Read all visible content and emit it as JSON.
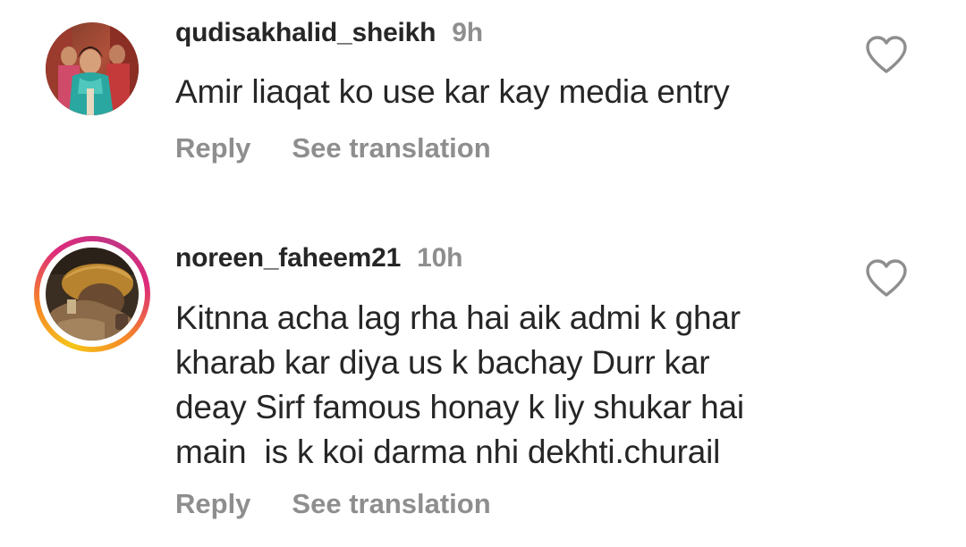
{
  "comments": [
    {
      "username": "qudisakhalid_sheikh",
      "time": "9h",
      "text": "Amir liaqat ko use kar kay media entry",
      "reply_label": "Reply",
      "translate_label": "See translation",
      "icon": "heart-outline-icon",
      "has_story_ring": false
    },
    {
      "username": "noreen_faheem21",
      "time": "10h",
      "text": "Kitnna acha lag rha hai aik admi k ghar\nkharab kar diya us k bachay Durr kar\ndeay Sirf famous honay k liy shukar hai\nmain  is k koi darma nhi dekhti.churail",
      "reply_label": "Reply",
      "translate_label": "See translation",
      "icon": "heart-outline-icon",
      "has_story_ring": true
    }
  ],
  "colors": {
    "text": "#262626",
    "secondary": "#8e8e8e",
    "background": "#ffffff",
    "story_ring": [
      "#f5c518",
      "#f58529",
      "#dd2a7b",
      "#c13584"
    ]
  }
}
